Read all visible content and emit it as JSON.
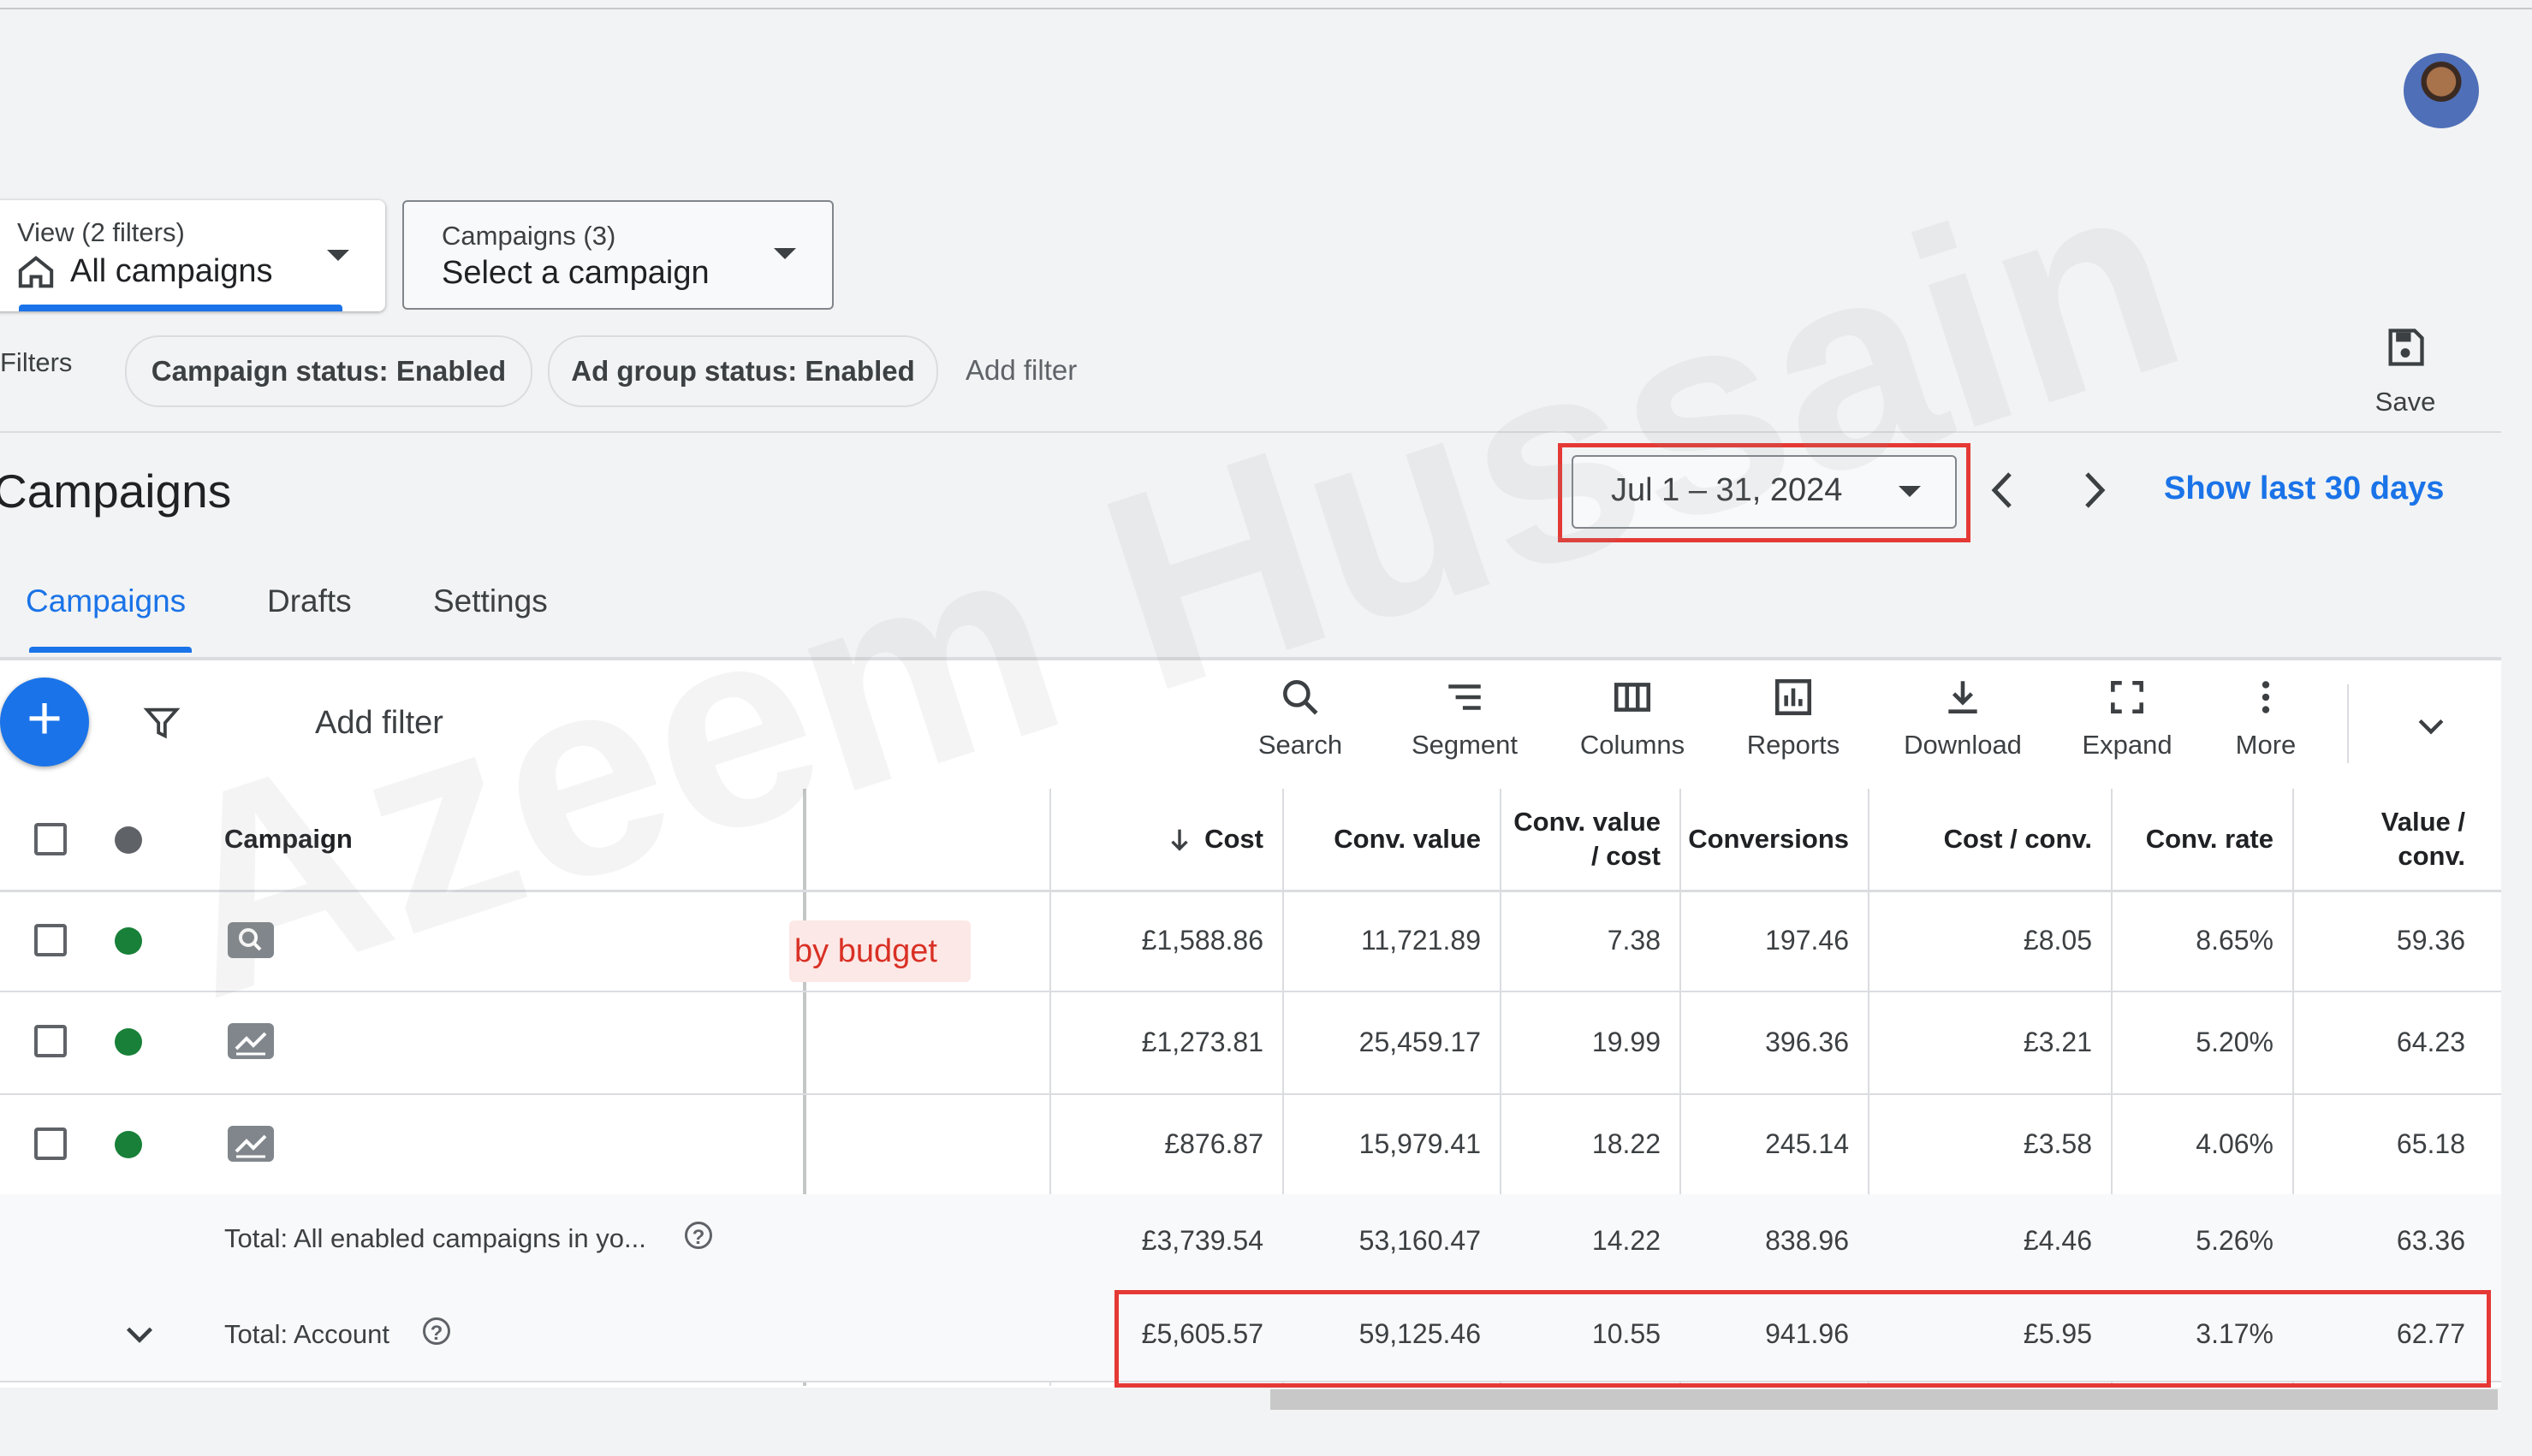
{
  "view_filter": {
    "label": "View (2 filters)",
    "value": "All campaigns"
  },
  "campaign_select": {
    "label": "Campaigns (3)",
    "value": "Select a campaign"
  },
  "filters": {
    "label": "Filters",
    "chips": [
      "Campaign status: Enabled",
      "Ad group status: Enabled"
    ],
    "add_filter": "Add filter"
  },
  "save_label": "Save",
  "page_title": "Campaigns",
  "date_range": {
    "value": "Jul 1 – 31, 2024",
    "show_last": "Show last 30 days"
  },
  "tabs": [
    "Campaigns",
    "Drafts",
    "Settings"
  ],
  "toolbar": {
    "add_filter": "Add filter",
    "tools": [
      "Search",
      "Segment",
      "Columns",
      "Reports",
      "Download",
      "Expand",
      "More"
    ]
  },
  "table": {
    "headers": {
      "campaign": "Campaign",
      "cost": "Cost",
      "conv_value": "Conv. value",
      "conv_value_cost_1": "Conv. value",
      "conv_value_cost_2": "/ cost",
      "conversions": "Conversions",
      "cost_conv": "Cost / conv.",
      "conv_rate": "Conv. rate",
      "value_conv_1": "Value /",
      "value_conv_2": "conv."
    },
    "status_badge": "by budget",
    "rows": [
      {
        "cost": "£1,588.86",
        "conv_value": "11,721.89",
        "conv_value_cost": "7.38",
        "conversions": "197.46",
        "cost_conv": "£8.05",
        "conv_rate": "8.65%",
        "value_conv": "59.36"
      },
      {
        "cost": "£1,273.81",
        "conv_value": "25,459.17",
        "conv_value_cost": "19.99",
        "conversions": "396.36",
        "cost_conv": "£3.21",
        "conv_rate": "5.20%",
        "value_conv": "64.23"
      },
      {
        "cost": "£876.87",
        "conv_value": "15,979.41",
        "conv_value_cost": "18.22",
        "conversions": "245.14",
        "cost_conv": "£3.58",
        "conv_rate": "4.06%",
        "value_conv": "65.18"
      }
    ],
    "total_enabled": {
      "label": "Total: All enabled campaigns in yo...",
      "cost": "£3,739.54",
      "conv_value": "53,160.47",
      "conv_value_cost": "14.22",
      "conversions": "838.96",
      "cost_conv": "£4.46",
      "conv_rate": "5.26%",
      "value_conv": "63.36"
    },
    "total_account": {
      "label": "Total: Account",
      "cost": "£5,605.57",
      "conv_value": "59,125.46",
      "conv_value_cost": "10.55",
      "conversions": "941.96",
      "cost_conv": "£5.95",
      "conv_rate": "3.17%",
      "value_conv": "62.77"
    }
  },
  "watermark": "Azeem Hussain",
  "colors": {
    "accent": "#1a73e8",
    "enabled": "#188038",
    "highlight": "#e53935"
  }
}
